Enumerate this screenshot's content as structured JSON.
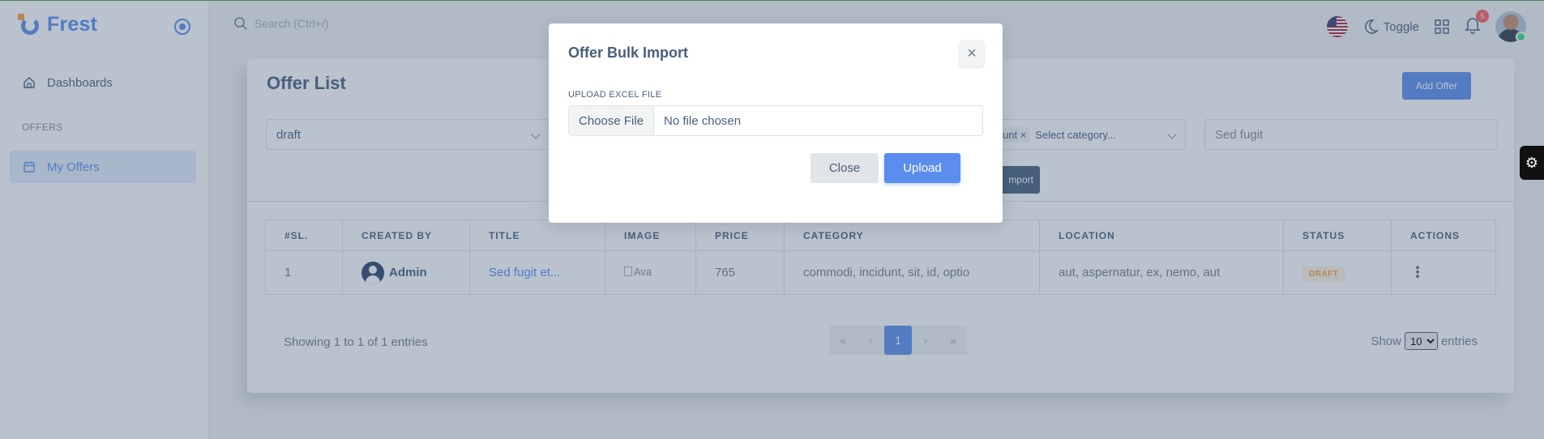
{
  "app": {
    "brand": "Frest"
  },
  "sidebar": {
    "items": [
      {
        "label": "Dashboards"
      }
    ],
    "section_label": "OFFERS",
    "offers_items": [
      {
        "label": "My Offers"
      }
    ]
  },
  "topbar": {
    "search_placeholder": "Search (Ctrl+/)",
    "toggle_label": "Toggle",
    "notifications_count": "5"
  },
  "page": {
    "title": "Offer List",
    "add_button": "Add Offer",
    "filters": {
      "status_value": "draft",
      "category_chip": "unt",
      "category_chip_remove": "×",
      "category_placeholder": "Select category...",
      "search_value": "Sed fugit"
    },
    "import_button": "mport"
  },
  "table": {
    "columns": [
      "#SL.",
      "CREATED BY",
      "TITLE",
      "IMAGE",
      "PRICE",
      "CATEGORY",
      "LOCATION",
      "STATUS",
      "ACTIONS"
    ],
    "rows": [
      {
        "sl": "1",
        "created_by": "Admin",
        "title": "Sed fugit et...",
        "image_alt": "Ava",
        "price": "765",
        "category": "commodi, incidunt, sit, id, optio",
        "location": "aut, aspernatur, ex, nemo, aut",
        "status": "DRAFT",
        "actions": "⋮"
      }
    ]
  },
  "footer": {
    "showing": "Showing 1 to 1 of 1 entries",
    "pagination": {
      "first": "«",
      "prev": "‹",
      "current": "1",
      "next": "›",
      "last": "»"
    },
    "show_label": "Show",
    "page_size": "10",
    "entries_label": "entries"
  },
  "modal": {
    "title": "Offer Bulk Import",
    "close_x": "×",
    "upload_label": "UPLOAD EXCEL FILE",
    "choose_file": "Choose File",
    "no_file": "No file chosen",
    "close_button": "Close",
    "upload_button": "Upload"
  },
  "colors": {
    "primary": "#5a8dee",
    "warning": "#ff9f43",
    "danger": "#ff5b5c",
    "text": "#475f7b"
  }
}
